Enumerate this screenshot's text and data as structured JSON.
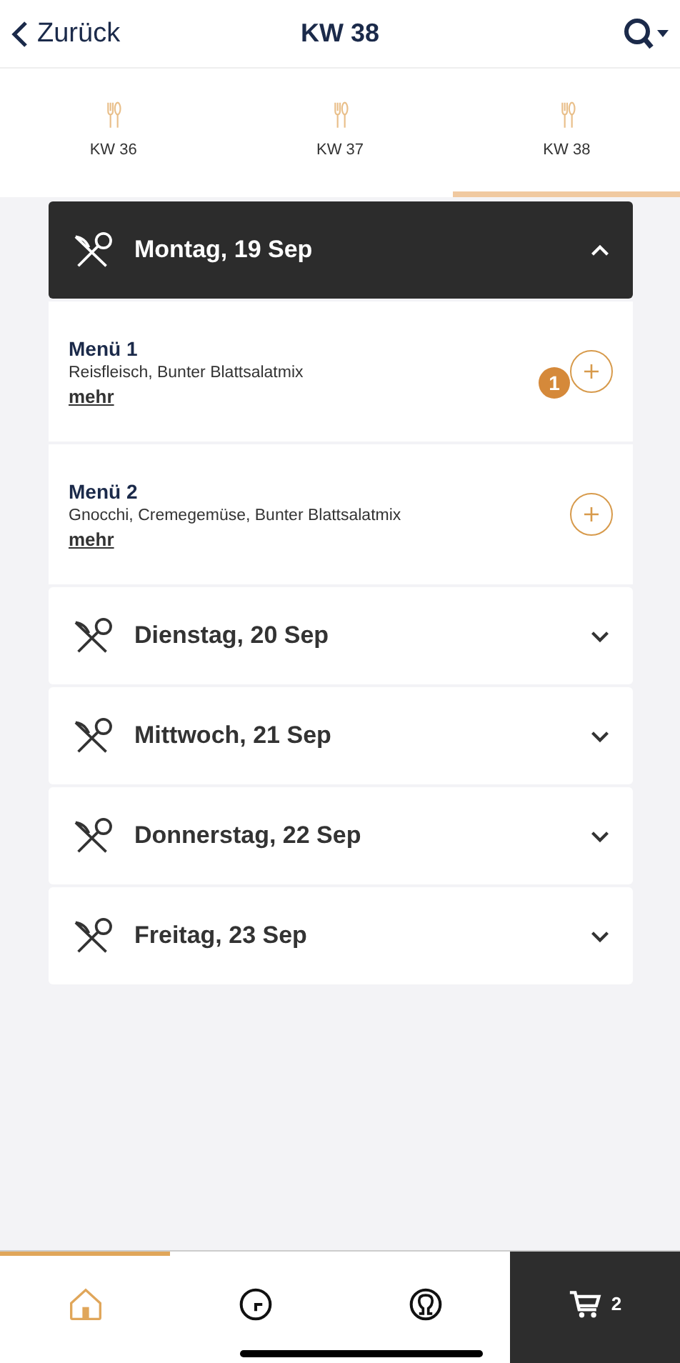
{
  "header": {
    "back": "Zurück",
    "title": "KW 38"
  },
  "week_tabs": [
    {
      "label": "KW 36",
      "selected": false
    },
    {
      "label": "KW 37",
      "selected": false
    },
    {
      "label": "KW 38",
      "selected": true
    }
  ],
  "days": [
    {
      "label": "Montag, 19 Sep",
      "expanded": true,
      "menus": [
        {
          "title": "Menü 1",
          "description": "Reisfleisch, Bunter Blattsalatmix",
          "more": "mehr",
          "count": "1"
        },
        {
          "title": "Menü 2",
          "description": "Gnocchi, Cremegemüse, Bunter Blattsalatmix",
          "more": "mehr"
        }
      ]
    },
    {
      "label": "Dienstag, 20 Sep",
      "expanded": false
    },
    {
      "label": "Mittwoch, 21 Sep",
      "expanded": false
    },
    {
      "label": "Donnerstag, 22 Sep",
      "expanded": false
    },
    {
      "label": "Freitag, 23 Sep",
      "expanded": false
    }
  ],
  "bottom_nav": [
    {
      "kind": "home",
      "selected": true
    },
    {
      "kind": "clock",
      "selected": false
    },
    {
      "kind": "profile",
      "selected": false
    },
    {
      "kind": "cart",
      "selected": false,
      "count": "2"
    }
  ]
}
